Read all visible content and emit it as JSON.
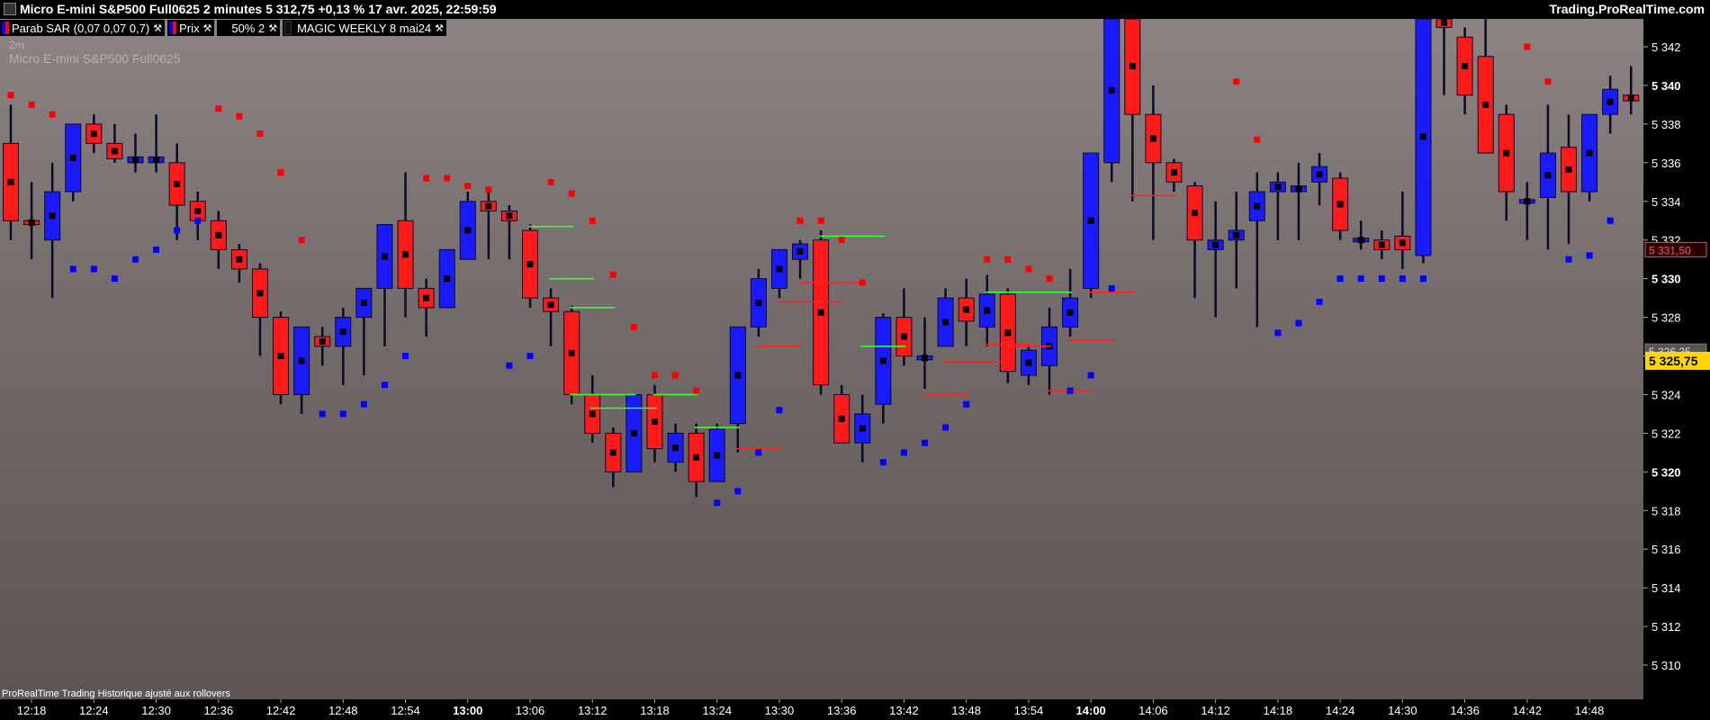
{
  "header": {
    "title": "Micro E-mini S&P500 Full0625 2 minutes 5 312,75 +0,13 % 17 avr. 2025, 22:59:59",
    "brand": "Trading.ProRealTime.com"
  },
  "toolbar": {
    "items": [
      {
        "label": "Parab SAR (0,07 0,07 0,7)"
      },
      {
        "label": "Prix"
      },
      {
        "label": "50% 2"
      },
      {
        "label": "MAGIC WEEKLY 8 mai24"
      }
    ]
  },
  "overlay": {
    "timeframe": "2m",
    "instrument": "Micro E-mini S&P500 Full0625",
    "footer": "ProRealTime Trading  Historique ajusté aux rollovers"
  },
  "colors": {
    "up": "#1a1aff",
    "down": "#ff1a1a",
    "wick": "#0a0a2a",
    "sar_up": "#0000ff",
    "sar_down": "#ff0000",
    "level_green": "#33ff33",
    "level_red": "#ff2020",
    "current_price_bg": "#ffd700",
    "marker_red": "#e05050",
    "marker_gray": "#8c8382"
  },
  "chart_data": {
    "type": "candlestick",
    "title": "Micro E-mini S&P500 Full0625",
    "timeframe": "2 minutes",
    "ylim": [
      5309,
      5343.5
    ],
    "y_ticks": [
      5310,
      5312,
      5314,
      5316,
      5318,
      5320,
      5322,
      5324,
      5326,
      5328,
      5330,
      5332,
      5334,
      5336,
      5338,
      5340,
      5342
    ],
    "y_tick_labels": [
      "5 310",
      "5 312",
      "5 314",
      "5 316",
      "5 318",
      "5 320",
      "5 322",
      "5 324",
      "5 326",
      "5 328",
      "5 330",
      "5 332",
      "5 334",
      "5 336",
      "5 338",
      "5 340",
      "5 342"
    ],
    "y_bold_ticks": [
      5320,
      5330,
      5340
    ],
    "x_tick_labels": [
      "12:18",
      "12:24",
      "12:30",
      "12:36",
      "12:42",
      "12:48",
      "12:54",
      "13:00",
      "13:06",
      "13:12",
      "13:18",
      "13:24",
      "13:30",
      "13:36",
      "13:42",
      "13:48",
      "13:54",
      "14:00",
      "14:06",
      "14:12",
      "14:18",
      "14:24",
      "14:30",
      "14:36",
      "14:42",
      "14:48"
    ],
    "x_tick_start_index": 1,
    "x_bold_labels": [
      "13:00",
      "14:00"
    ],
    "current_price_label": "5 325,75",
    "current_price": 5325.75,
    "price_markers": [
      {
        "value": 5331.5,
        "label": "5 331,50",
        "style": "red"
      },
      {
        "value": 5326.25,
        "label": "5 326,25",
        "style": "gray"
      }
    ],
    "candles": [
      {
        "o": 5337,
        "h": 5339,
        "l": 5332,
        "c": 5333
      },
      {
        "o": 5333,
        "h": 5335,
        "l": 5331,
        "c": 5332.8
      },
      {
        "o": 5332,
        "h": 5336,
        "l": 5329,
        "c": 5334.5
      },
      {
        "o": 5334.5,
        "h": 5338,
        "l": 5334,
        "c": 5338
      },
      {
        "o": 5338,
        "h": 5338.5,
        "l": 5336.5,
        "c": 5337
      },
      {
        "o": 5337,
        "h": 5338,
        "l": 5336,
        "c": 5336.2
      },
      {
        "o": 5336,
        "h": 5337.5,
        "l": 5335.5,
        "c": 5336.3
      },
      {
        "o": 5336,
        "h": 5338.5,
        "l": 5335.5,
        "c": 5336.3
      },
      {
        "o": 5336,
        "h": 5337,
        "l": 5332,
        "c": 5333.8
      },
      {
        "o": 5334,
        "h": 5334.5,
        "l": 5332,
        "c": 5333
      },
      {
        "o": 5333,
        "h": 5333.5,
        "l": 5330.5,
        "c": 5331.5
      },
      {
        "o": 5331.5,
        "h": 5331.8,
        "l": 5329.8,
        "c": 5330.5
      },
      {
        "o": 5330.5,
        "h": 5330.8,
        "l": 5326,
        "c": 5328
      },
      {
        "o": 5328,
        "h": 5328.3,
        "l": 5323.5,
        "c": 5324
      },
      {
        "o": 5324,
        "h": 5327.5,
        "l": 5323,
        "c": 5327.5
      },
      {
        "o": 5327,
        "h": 5327.5,
        "l": 5325.5,
        "c": 5326.5
      },
      {
        "o": 5326.5,
        "h": 5328.5,
        "l": 5324.5,
        "c": 5328
      },
      {
        "o": 5328,
        "h": 5329.5,
        "l": 5325,
        "c": 5329.5
      },
      {
        "o": 5329.5,
        "h": 5332,
        "l": 5326.5,
        "c": 5332.8
      },
      {
        "o": 5333,
        "h": 5335.5,
        "l": 5328,
        "c": 5329.5
      },
      {
        "o": 5329.5,
        "h": 5330,
        "l": 5327,
        "c": 5328.5
      },
      {
        "o": 5328.5,
        "h": 5331.5,
        "l": 5328.5,
        "c": 5331.5
      },
      {
        "o": 5331,
        "h": 5334.5,
        "l": 5331,
        "c": 5334
      },
      {
        "o": 5334,
        "h": 5334.5,
        "l": 5331,
        "c": 5333.5
      },
      {
        "o": 5333.5,
        "h": 5333.8,
        "l": 5331,
        "c": 5333
      },
      {
        "o": 5332.5,
        "h": 5332.8,
        "l": 5328.5,
        "c": 5329
      },
      {
        "o": 5329,
        "h": 5329.5,
        "l": 5326.5,
        "c": 5328.3
      },
      {
        "o": 5328.3,
        "h": 5328.6,
        "l": 5323.5,
        "c": 5324
      },
      {
        "o": 5324,
        "h": 5325,
        "l": 5321.5,
        "c": 5322
      },
      {
        "o": 5322,
        "h": 5322.3,
        "l": 5319.2,
        "c": 5320
      },
      {
        "o": 5320,
        "h": 5324,
        "l": 5320,
        "c": 5324
      },
      {
        "o": 5324,
        "h": 5324.5,
        "l": 5320.5,
        "c": 5321.2
      },
      {
        "o": 5320.5,
        "h": 5322.5,
        "l": 5320,
        "c": 5322
      },
      {
        "o": 5322,
        "h": 5322.5,
        "l": 5318.7,
        "c": 5319.5
      },
      {
        "o": 5319.5,
        "h": 5322.5,
        "l": 5319.5,
        "c": 5322.2
      },
      {
        "o": 5322.5,
        "h": 5327.5,
        "l": 5321,
        "c": 5327.5
      },
      {
        "o": 5327.5,
        "h": 5330.5,
        "l": 5327,
        "c": 5330
      },
      {
        "o": 5329.5,
        "h": 5331.5,
        "l": 5329,
        "c": 5331.5
      },
      {
        "o": 5331,
        "h": 5332,
        "l": 5330,
        "c": 5331.8
      },
      {
        "o": 5332,
        "h": 5332.5,
        "l": 5324,
        "c": 5324.5
      },
      {
        "o": 5324,
        "h": 5324.5,
        "l": 5321.5,
        "c": 5321.5
      },
      {
        "o": 5321.5,
        "h": 5324,
        "l": 5320.5,
        "c": 5323
      },
      {
        "o": 5323.5,
        "h": 5328.2,
        "l": 5322.5,
        "c": 5328
      },
      {
        "o": 5328,
        "h": 5329.5,
        "l": 5325.5,
        "c": 5326
      },
      {
        "o": 5325.8,
        "h": 5328,
        "l": 5324.3,
        "c": 5326
      },
      {
        "o": 5326.5,
        "h": 5329.5,
        "l": 5326.5,
        "c": 5329
      },
      {
        "o": 5329,
        "h": 5330,
        "l": 5326.5,
        "c": 5327.8
      },
      {
        "o": 5327.5,
        "h": 5330.2,
        "l": 5326.5,
        "c": 5329.2
      },
      {
        "o": 5329.2,
        "h": 5329.5,
        "l": 5324.6,
        "c": 5325.2
      },
      {
        "o": 5325,
        "h": 5326.5,
        "l": 5324.5,
        "c": 5326.3
      },
      {
        "o": 5325.5,
        "h": 5328.5,
        "l": 5324,
        "c": 5327.5
      },
      {
        "o": 5327.5,
        "h": 5330.5,
        "l": 5327,
        "c": 5329
      },
      {
        "o": 5329.5,
        "h": 5336.5,
        "l": 5329,
        "c": 5336.5
      },
      {
        "o": 5336,
        "h": 5343.5,
        "l": 5335,
        "c": 5343.5
      },
      {
        "o": 5343.5,
        "h": 5343.5,
        "l": 5334,
        "c": 5338.5
      },
      {
        "o": 5338.5,
        "h": 5340,
        "l": 5332,
        "c": 5336
      },
      {
        "o": 5336,
        "h": 5336.2,
        "l": 5334.5,
        "c": 5335
      },
      {
        "o": 5334.8,
        "h": 5335,
        "l": 5329,
        "c": 5332
      },
      {
        "o": 5331.5,
        "h": 5334,
        "l": 5328,
        "c": 5332
      },
      {
        "o": 5332,
        "h": 5334.5,
        "l": 5329.5,
        "c": 5332.5
      },
      {
        "o": 5333,
        "h": 5335.5,
        "l": 5327.5,
        "c": 5334.5
      },
      {
        "o": 5334.5,
        "h": 5335.5,
        "l": 5332,
        "c": 5335
      },
      {
        "o": 5334.5,
        "h": 5336,
        "l": 5332,
        "c": 5334.8
      },
      {
        "o": 5335,
        "h": 5336.5,
        "l": 5333.8,
        "c": 5335.8
      },
      {
        "o": 5335.2,
        "h": 5335.5,
        "l": 5332,
        "c": 5332.5
      },
      {
        "o": 5332,
        "h": 5333,
        "l": 5331.5,
        "c": 5332
      },
      {
        "o": 5332,
        "h": 5332.5,
        "l": 5331,
        "c": 5331.5
      },
      {
        "o": 5332.2,
        "h": 5334.5,
        "l": 5330.5,
        "c": 5331.5
      },
      {
        "o": 5331.2,
        "h": 5343.5,
        "l": 5330.8,
        "c": 5343.5
      },
      {
        "o": 5343.5,
        "h": 5343.5,
        "l": 5339.5,
        "c": 5343
      },
      {
        "o": 5342.5,
        "h": 5343,
        "l": 5338.5,
        "c": 5339.5
      },
      {
        "o": 5341.5,
        "h": 5343.5,
        "l": 5336.5,
        "c": 5336.5
      },
      {
        "o": 5338.5,
        "h": 5339,
        "l": 5333,
        "c": 5334.5
      },
      {
        "o": 5334,
        "h": 5335,
        "l": 5332,
        "c": 5334
      },
      {
        "o": 5334.2,
        "h": 5339,
        "l": 5331.5,
        "c": 5336.5
      },
      {
        "o": 5336.8,
        "h": 5338.5,
        "l": 5331.8,
        "c": 5334.5
      },
      {
        "o": 5334.5,
        "h": 5338.5,
        "l": 5334,
        "c": 5338.5
      },
      {
        "o": 5338.5,
        "h": 5340.5,
        "l": 5337.5,
        "c": 5339.8
      },
      {
        "o": 5339.5,
        "h": 5341,
        "l": 5338.5,
        "c": 5339.2
      }
    ],
    "sar_points": [
      {
        "i": 0,
        "v": 5339.5,
        "side": "down"
      },
      {
        "i": 1,
        "v": 5339,
        "side": "down"
      },
      {
        "i": 2,
        "v": 5338.5,
        "side": "down"
      },
      {
        "i": 3,
        "v": 5330.5,
        "side": "up"
      },
      {
        "i": 4,
        "v": 5330.5,
        "side": "up"
      },
      {
        "i": 5,
        "v": 5330,
        "side": "up"
      },
      {
        "i": 6,
        "v": 5331,
        "side": "up"
      },
      {
        "i": 7,
        "v": 5331.5,
        "side": "up"
      },
      {
        "i": 8,
        "v": 5332.5,
        "side": "up"
      },
      {
        "i": 9,
        "v": 5333,
        "side": "up"
      },
      {
        "i": 10,
        "v": 5338.8,
        "side": "down"
      },
      {
        "i": 11,
        "v": 5338.4,
        "side": "down"
      },
      {
        "i": 12,
        "v": 5337.5,
        "side": "down"
      },
      {
        "i": 13,
        "v": 5335.5,
        "side": "down"
      },
      {
        "i": 14,
        "v": 5332,
        "side": "down"
      },
      {
        "i": 15,
        "v": 5323,
        "side": "up"
      },
      {
        "i": 16,
        "v": 5323,
        "side": "up"
      },
      {
        "i": 17,
        "v": 5323.5,
        "side": "up"
      },
      {
        "i": 18,
        "v": 5324.5,
        "side": "up"
      },
      {
        "i": 19,
        "v": 5326,
        "side": "up"
      },
      {
        "i": 20,
        "v": 5335.2,
        "side": "down"
      },
      {
        "i": 21,
        "v": 5335.2,
        "side": "down"
      },
      {
        "i": 22,
        "v": 5334.8,
        "side": "down"
      },
      {
        "i": 23,
        "v": 5334.6,
        "side": "down"
      },
      {
        "i": 24,
        "v": 5325.5,
        "side": "up"
      },
      {
        "i": 25,
        "v": 5326,
        "side": "up"
      },
      {
        "i": 26,
        "v": 5335,
        "side": "down"
      },
      {
        "i": 27,
        "v": 5334.4,
        "side": "down"
      },
      {
        "i": 28,
        "v": 5333,
        "side": "down"
      },
      {
        "i": 29,
        "v": 5330.2,
        "side": "down"
      },
      {
        "i": 30,
        "v": 5327.5,
        "side": "down"
      },
      {
        "i": 31,
        "v": 5325,
        "side": "down"
      },
      {
        "i": 32,
        "v": 5325,
        "side": "down"
      },
      {
        "i": 33,
        "v": 5324.2,
        "side": "down"
      },
      {
        "i": 34,
        "v": 5318.4,
        "side": "up"
      },
      {
        "i": 35,
        "v": 5319,
        "side": "up"
      },
      {
        "i": 36,
        "v": 5321,
        "side": "up"
      },
      {
        "i": 37,
        "v": 5323.2,
        "side": "up"
      },
      {
        "i": 38,
        "v": 5333,
        "side": "down"
      },
      {
        "i": 39,
        "v": 5333,
        "side": "down"
      },
      {
        "i": 40,
        "v": 5332,
        "side": "down"
      },
      {
        "i": 41,
        "v": 5329.8,
        "side": "down"
      },
      {
        "i": 42,
        "v": 5320.5,
        "side": "up"
      },
      {
        "i": 43,
        "v": 5321,
        "side": "up"
      },
      {
        "i": 44,
        "v": 5321.5,
        "side": "up"
      },
      {
        "i": 45,
        "v": 5322.3,
        "side": "up"
      },
      {
        "i": 46,
        "v": 5323.5,
        "side": "up"
      },
      {
        "i": 47,
        "v": 5331,
        "side": "down"
      },
      {
        "i": 48,
        "v": 5331,
        "side": "down"
      },
      {
        "i": 49,
        "v": 5330.5,
        "side": "down"
      },
      {
        "i": 50,
        "v": 5330,
        "side": "down"
      },
      {
        "i": 51,
        "v": 5324.2,
        "side": "up"
      },
      {
        "i": 52,
        "v": 5325,
        "side": "up"
      },
      {
        "i": 53,
        "v": 5329.5,
        "side": "up"
      },
      {
        "i": 59,
        "v": 5340.2,
        "side": "down"
      },
      {
        "i": 60,
        "v": 5337.2,
        "side": "down"
      },
      {
        "i": 61,
        "v": 5327.2,
        "side": "up"
      },
      {
        "i": 62,
        "v": 5327.7,
        "side": "up"
      },
      {
        "i": 63,
        "v": 5328.8,
        "side": "up"
      },
      {
        "i": 64,
        "v": 5330,
        "side": "up"
      },
      {
        "i": 65,
        "v": 5330,
        "side": "up"
      },
      {
        "i": 66,
        "v": 5330,
        "side": "up"
      },
      {
        "i": 67,
        "v": 5330,
        "side": "up"
      },
      {
        "i": 68,
        "v": 5330,
        "side": "up"
      },
      {
        "i": 73,
        "v": 5342,
        "side": "down"
      },
      {
        "i": 74,
        "v": 5340.2,
        "side": "down"
      },
      {
        "i": 75,
        "v": 5331,
        "side": "up"
      },
      {
        "i": 76,
        "v": 5331.2,
        "side": "up"
      },
      {
        "i": 77,
        "v": 5333,
        "side": "up"
      }
    ],
    "levels": [
      {
        "i0": 25,
        "i1": 27,
        "v": 5332.7,
        "color": "green"
      },
      {
        "i0": 26,
        "i1": 28,
        "v": 5330,
        "color": "green"
      },
      {
        "i0": 27,
        "i1": 29,
        "v": 5328.5,
        "color": "green"
      },
      {
        "i0": 27,
        "i1": 30,
        "v": 5324,
        "color": "green"
      },
      {
        "i0": 28,
        "i1": 31,
        "v": 5323.3,
        "color": "green"
      },
      {
        "i0": 31,
        "i1": 33,
        "v": 5324,
        "color": "green"
      },
      {
        "i0": 33,
        "i1": 35,
        "v": 5322.3,
        "color": "green"
      },
      {
        "i0": 35,
        "i1": 37,
        "v": 5321.2,
        "color": "red"
      },
      {
        "i0": 36,
        "i1": 38,
        "v": 5326.5,
        "color": "red"
      },
      {
        "i0": 37,
        "i1": 40,
        "v": 5328.8,
        "color": "red"
      },
      {
        "i0": 38,
        "i1": 41,
        "v": 5329.8,
        "color": "red"
      },
      {
        "i0": 39,
        "i1": 42,
        "v": 5332.2,
        "color": "green"
      },
      {
        "i0": 41,
        "i1": 43,
        "v": 5326.5,
        "color": "green"
      },
      {
        "i0": 44,
        "i1": 46,
        "v": 5324,
        "color": "red"
      },
      {
        "i0": 45,
        "i1": 48,
        "v": 5325.7,
        "color": "red"
      },
      {
        "i0": 47,
        "i1": 49,
        "v": 5326.6,
        "color": "red"
      },
      {
        "i0": 47,
        "i1": 51,
        "v": 5329.3,
        "color": "green"
      },
      {
        "i0": 48,
        "i1": 50,
        "v": 5326.5,
        "color": "red"
      },
      {
        "i0": 50,
        "i1": 52,
        "v": 5324.2,
        "color": "red"
      },
      {
        "i0": 51,
        "i1": 53,
        "v": 5326.8,
        "color": "red"
      },
      {
        "i0": 52,
        "i1": 54,
        "v": 5329.3,
        "color": "red"
      },
      {
        "i0": 54,
        "i1": 56,
        "v": 5334.3,
        "color": "red"
      }
    ]
  }
}
